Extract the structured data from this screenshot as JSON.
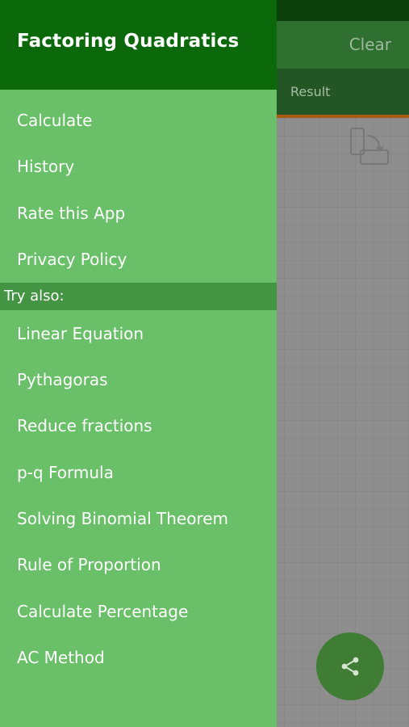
{
  "app": {
    "clear_label": "Clear",
    "result_tab_label": "Result",
    "share_icon": "share-icon",
    "rotate_icon": "rotate-device-icon"
  },
  "drawer": {
    "title": "Factoring Quadratics",
    "items": [
      {
        "label": "Calculate"
      },
      {
        "label": "History"
      },
      {
        "label": "Rate this App"
      },
      {
        "label": "Privacy Policy"
      }
    ],
    "section_label": "Try also:",
    "also_items": [
      {
        "label": "Linear Equation"
      },
      {
        "label": "Pythagoras"
      },
      {
        "label": "Reduce fractions"
      },
      {
        "label": "p-q Formula"
      },
      {
        "label": "Solving Binomial Theorem"
      },
      {
        "label": "Rule of Proportion"
      },
      {
        "label": "Calculate Percentage"
      },
      {
        "label": "AC Method"
      }
    ]
  },
  "colors": {
    "drawer_bg": "#6abf69",
    "drawer_header": "#0b690b",
    "section_band": "#439443",
    "accent_indicator": "#a85d12",
    "fab": "#3f7d35"
  }
}
